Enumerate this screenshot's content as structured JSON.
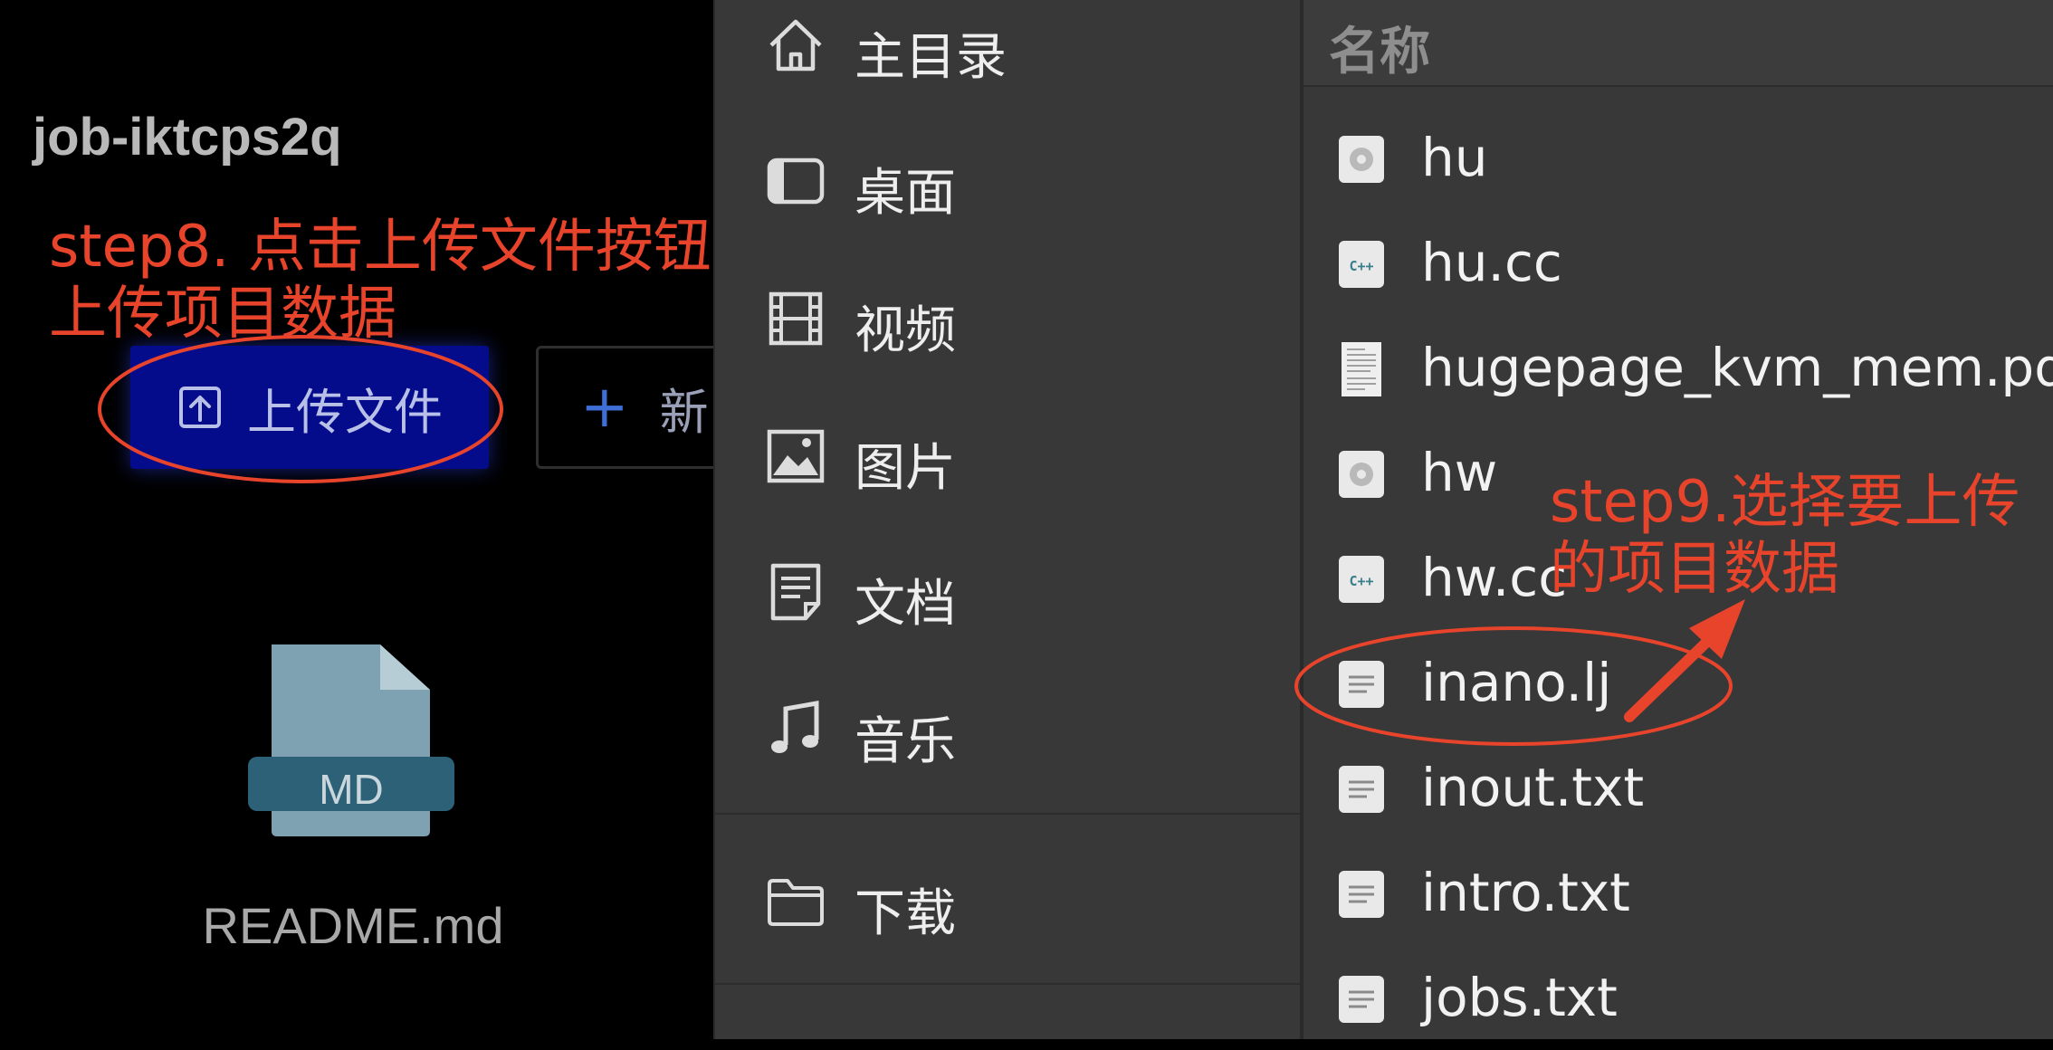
{
  "left": {
    "job_title": "job-iktcps2q",
    "upload_button": "上传文件",
    "new_button": "新",
    "md_badge": "MD",
    "md_filename": "README.md"
  },
  "places": [
    {
      "label": "主目录",
      "icon": "home-icon"
    },
    {
      "label": "桌面",
      "icon": "desktop-icon"
    },
    {
      "label": "视频",
      "icon": "video-icon"
    },
    {
      "label": "图片",
      "icon": "image-icon"
    },
    {
      "label": "文档",
      "icon": "document-icon"
    },
    {
      "label": "音乐",
      "icon": "music-icon"
    },
    {
      "label": "下载",
      "icon": "folder-icon"
    }
  ],
  "files": {
    "header": "名称",
    "items": [
      {
        "name": "hu",
        "icon": "executable-icon"
      },
      {
        "name": "hu.cc",
        "icon": "cpp-file-icon"
      },
      {
        "name": "hugepage_kvm_mem.pdf",
        "icon": "pdf-file-icon"
      },
      {
        "name": "hw",
        "icon": "executable-icon"
      },
      {
        "name": "hw.cc",
        "icon": "cpp-file-icon"
      },
      {
        "name": "inano.lj",
        "icon": "text-file-icon"
      },
      {
        "name": "inout.txt",
        "icon": "text-file-icon"
      },
      {
        "name": "intro.txt",
        "icon": "text-file-icon"
      },
      {
        "name": "jobs.txt",
        "icon": "text-file-icon"
      }
    ]
  },
  "annotations": {
    "step8_line1": "step8. 点击上传文件按钮",
    "step8_line2": "上传项目数据",
    "step9_line1": "step9.选择要上传",
    "step9_line2": "的项目数据"
  },
  "colors": {
    "annotation": "#e8442c",
    "upload_button_bg": "#050c8c",
    "chooser_bg": "#383838"
  }
}
